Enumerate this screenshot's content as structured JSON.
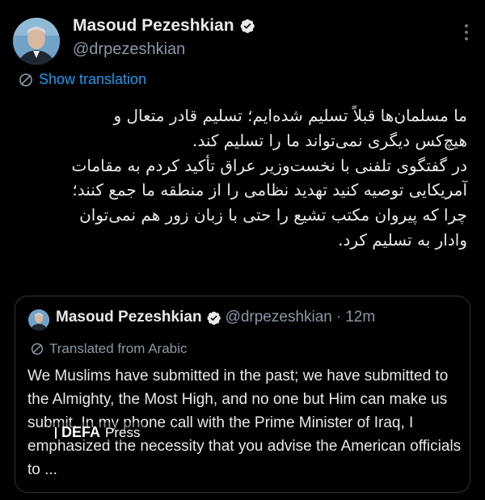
{
  "post": {
    "author_name": "Masoud Pezeshkian",
    "author_handle": "@drpezeshkian",
    "show_translation_label": "Show translation",
    "text": "ما مسلمان‌ها قبلاً تسلیم شده‌ایم؛ تسلیم قادر متعال و\nهیچ‌کس دیگری نمی‌تواند ما را تسلیم کند.\nدر گفتگوی تلفنی با نخست‌وزیر عراق تأکید کردم به مقامات\nآمریکایی توصیه کنید تهدید نظامی را از منطقه ما جمع کنند؛\nچرا که پیروان مکتب تشیع را حتی با زبان زور هم نمی‌توان\nوادار به تسلیم کرد."
  },
  "quoted_post": {
    "author_name": "Masoud Pezeshkian",
    "author_handle": "@drpezeshkian",
    "separator": "·",
    "time": "12m",
    "translated_label": "Translated from Arabic",
    "text": "We Muslims have submitted in the past; we have submitted to the Almighty, the Most High, and no one but Him can make us submit. In my phone call with the Prime Minister of Iraq, I emphasized the necessity that you advise the American officials to ..."
  },
  "watermark": {
    "brand": "DEFA",
    "suffix": "Press"
  },
  "icons": {
    "verified": "verified-badge-icon",
    "more": "more-options-icon",
    "translate": "translate-globe-icon"
  },
  "colors": {
    "background": "#000000",
    "text": "#e7e9ea",
    "secondary": "#8b98a5",
    "link": "#1d9bf0",
    "border": "#2f3336"
  }
}
